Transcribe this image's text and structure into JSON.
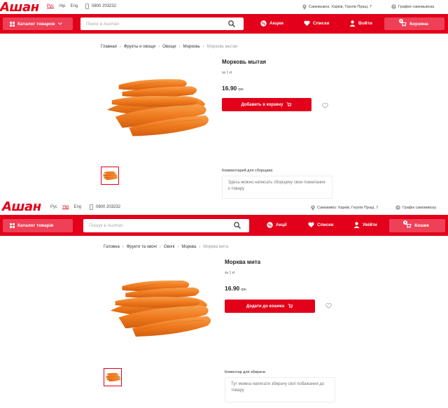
{
  "brand": {
    "logo_text": "Ашан",
    "accent": "#e2001a",
    "cart_button_color": "#ee4056"
  },
  "screens": [
    {
      "langs": [
        "Рус",
        "Укр",
        "Eng"
      ],
      "active_lang": "Рус",
      "phone": "0800 203232",
      "address": "Самовывоз: Харків, Героїв Праці, 7",
      "schedule": "График самовывоза",
      "catalog_label": "Каталог товаров",
      "search_placeholder": "Поиск в Auchan",
      "nav": {
        "promo": "Акции",
        "lists": "Списки",
        "login": "Войти",
        "cart": "Корзина"
      },
      "cart_count": "0",
      "breadcrumbs": [
        "Главная",
        "Фрукты и овощи",
        "Овощи",
        "Морковь",
        "Морковь мытая"
      ],
      "product": {
        "title": "Морковь мытая",
        "unit": "за 1 кг",
        "price": "16.90",
        "currency": "грн",
        "buy_label": "Добавить в корзину",
        "comment_label": "Комментарий для сборщика",
        "comment_placeholder": "Здесь можно написать сборщику свои пожелания к товару"
      }
    },
    {
      "langs": [
        "Рус",
        "Укр",
        "Eng"
      ],
      "active_lang": "Укр",
      "phone": "0800 203232",
      "address": "Самовивіз: Харків, Героїв Праці, 7",
      "schedule": "Графік самовивозу",
      "catalog_label": "Каталог товарів",
      "search_placeholder": "Пошук в Auchan",
      "nav": {
        "promo": "Акції",
        "lists": "Списки",
        "login": "Увійти",
        "cart": "Кошик"
      },
      "cart_count": "0",
      "breadcrumbs": [
        "Головна",
        "Фрукти та овочі",
        "Овочі",
        "Морква",
        "Морква мита"
      ],
      "product": {
        "title": "Морква мита",
        "unit": "за 1 кг",
        "price": "16.90",
        "currency": "грн",
        "buy_label": "Додати до кошика",
        "comment_label": "Коментар для збирача",
        "comment_placeholder": "Тут можна написати збирачу свої побажання до товару"
      }
    }
  ]
}
